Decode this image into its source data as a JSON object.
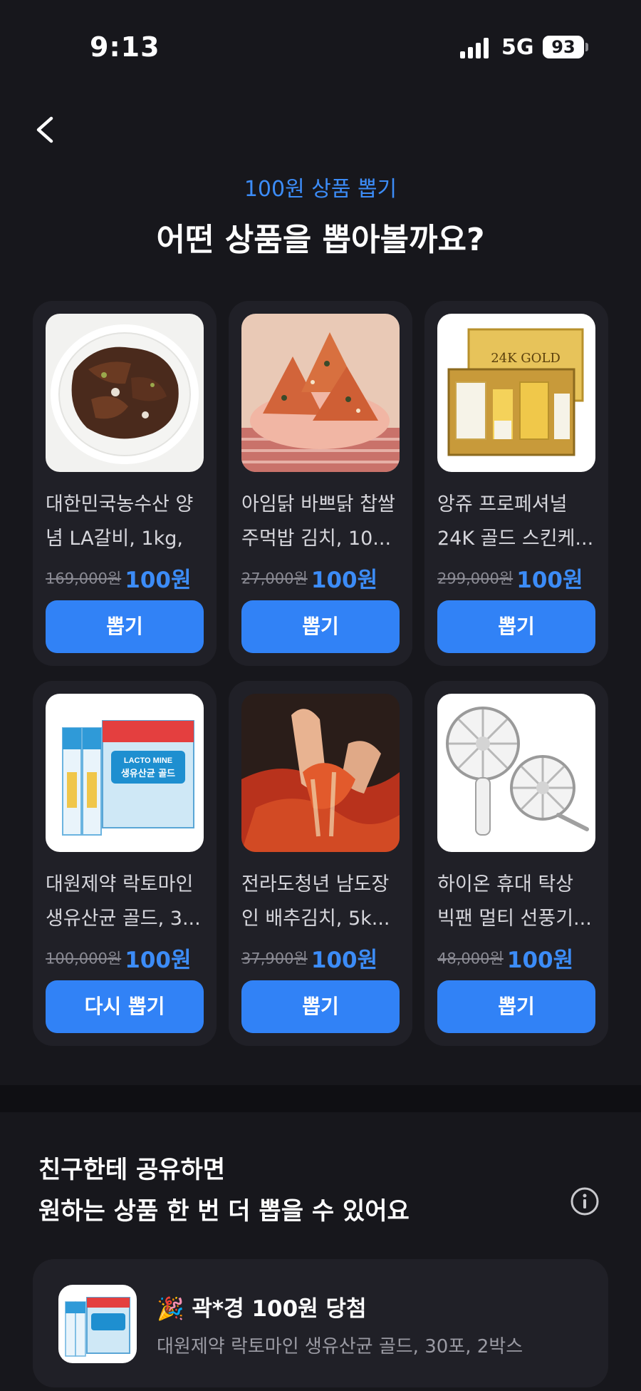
{
  "status_bar": {
    "time": "9:13",
    "network": "5G",
    "battery": "93"
  },
  "header": {
    "subtitle": "100원 상품 뽑기",
    "title": "어떤 상품을 뽑아볼까요?"
  },
  "products": [
    {
      "name": "대한민국농수산 양념 LA갈비, 1kg, ...",
      "original_price": "169,000원",
      "sale_price": "100원",
      "button": "뽑기",
      "image": "galbi"
    },
    {
      "name": "아임닭 바쁘닭 찹쌀 주먹밥 김치, 10...",
      "original_price": "27,000원",
      "sale_price": "100원",
      "button": "뽑기",
      "image": "rice-ball"
    },
    {
      "name": "앙쥬 프로페셔널 24K 골드 스킨케...",
      "original_price": "299,000원",
      "sale_price": "100원",
      "button": "뽑기",
      "image": "gold-skincare"
    },
    {
      "name": "대원제약 락토마인 생유산균 골드, 3...",
      "original_price": "100,000원",
      "sale_price": "100원",
      "button": "다시 뽑기",
      "image": "probiotic"
    },
    {
      "name": "전라도청년 남도장인 배추김치, 5k...",
      "original_price": "37,900원",
      "sale_price": "100원",
      "button": "뽑기",
      "image": "kimchi"
    },
    {
      "name": "하이온 휴대 탁상 빅팬 멀티 선풍기...",
      "original_price": "48,000원",
      "sale_price": "100원",
      "button": "뽑기",
      "image": "fan"
    }
  ],
  "product_image_text": {
    "gold_box": "24K GOLD",
    "probiotic_brand": "LACTO MINE",
    "probiotic_label": "생유산균 골드"
  },
  "share": {
    "title_line1": "친구한테 공유하면",
    "title_line2": "원하는 상품 한 번 더 뽑을 수 있어요"
  },
  "winner": {
    "emoji": "🎉",
    "title": "곽*경 100원 당첨",
    "description": "대원제약 락토마인 생유산균 골드, 30포, 2박스"
  },
  "colors": {
    "accent": "#3182f6",
    "accent_text": "#3c8cf7",
    "background": "#17171c",
    "card": "#202027"
  }
}
